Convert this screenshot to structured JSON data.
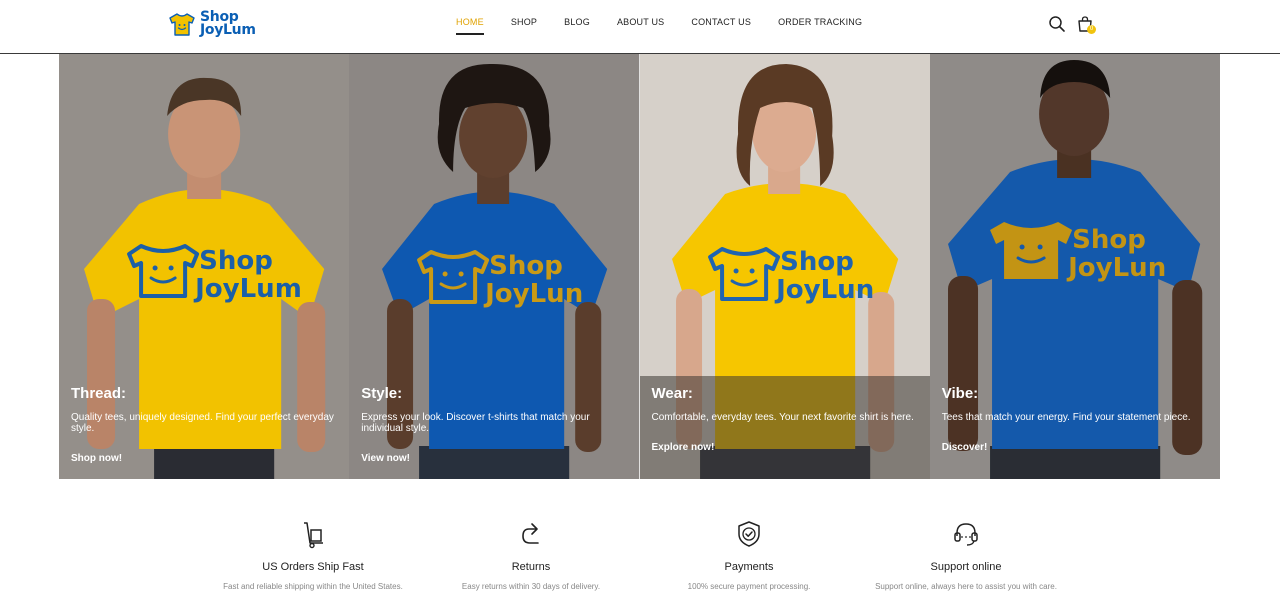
{
  "brand": {
    "line1": "Shop",
    "line2": "JoyLum"
  },
  "nav": [
    {
      "label": "HOME",
      "active": true
    },
    {
      "label": "SHOP",
      "active": false
    },
    {
      "label": "BLOG",
      "active": false
    },
    {
      "label": "ABOUT US",
      "active": false
    },
    {
      "label": "CONTACT US",
      "active": false
    },
    {
      "label": "ORDER TRACKING",
      "active": false
    }
  ],
  "header_icons": {
    "search": "search-icon",
    "cart": "shopping-bag-icon",
    "cart_count": "0"
  },
  "panels": [
    {
      "title": "Thread:",
      "text": "Quality tees, uniquely designed. Find your perfect everyday style.",
      "link": "Shop now!",
      "shirt_print_line1": "Shop",
      "shirt_print_line2": "JoyLum",
      "shirt_color": "#f2c200",
      "print_color": "#1b5fa8"
    },
    {
      "title": "Style:",
      "text": "Express your look. Discover t-shirts that match your individual style.",
      "link": "View now!",
      "shirt_print_line1": "Shop",
      "shirt_print_line2": "JoyLun",
      "shirt_color": "#0e58b0",
      "print_color": "#c99a16"
    },
    {
      "title": "Wear:",
      "text": "Comfortable, everyday tees. Your next favorite shirt is here.",
      "link": "Explore now!",
      "shirt_print_line1": "Shop",
      "shirt_print_line2": "JoyLun",
      "shirt_color": "#f6c600",
      "print_color": "#1f64b0"
    },
    {
      "title": "Vibe:",
      "text": "Tees that match your energy. Find your statement piece.",
      "link": "Discover!",
      "shirt_print_line1": "Shop",
      "shirt_print_line2": "JoyLun",
      "shirt_color": "#1459ab",
      "print_color": "#c39414"
    }
  ],
  "features": [
    {
      "icon": "hand-truck-icon",
      "title": "US Orders Ship Fast",
      "text": "Fast and reliable shipping within the United States."
    },
    {
      "icon": "return-arrow-icon",
      "title": "Returns",
      "text": "Easy returns within 30 days of delivery."
    },
    {
      "icon": "shield-check-icon",
      "title": "Payments",
      "text": "100% secure payment processing."
    },
    {
      "icon": "headset-icon",
      "title": "Support online",
      "text": "Support online, always here to assist you with care."
    }
  ],
  "colors": {
    "accent": "#e0a200",
    "brand_blue": "#0b5fb4",
    "badge": "#f1c40f"
  }
}
